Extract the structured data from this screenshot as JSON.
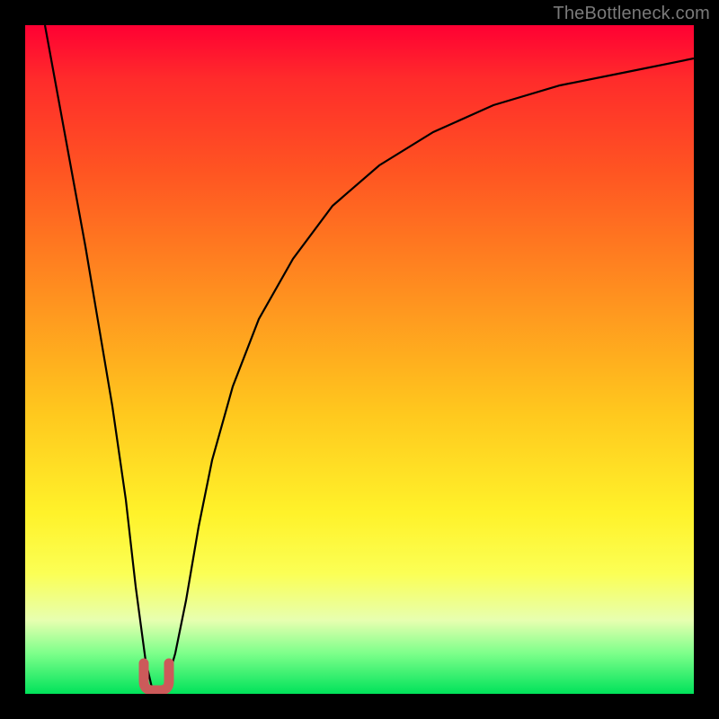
{
  "watermark": {
    "text": "TheBottleneck.com"
  },
  "chart_data": {
    "type": "line",
    "title": "",
    "xlabel": "",
    "ylabel": "",
    "xlim": [
      0,
      100
    ],
    "ylim": [
      0,
      100
    ],
    "grid": false,
    "legend": false,
    "background_gradient": {
      "direction": "vertical",
      "stops": [
        {
          "pos": 0,
          "color": "#ff0033"
        },
        {
          "pos": 22,
          "color": "#ff5522"
        },
        {
          "pos": 58,
          "color": "#ffc81e"
        },
        {
          "pos": 82,
          "color": "#fbff55"
        },
        {
          "pos": 100,
          "color": "#00e25a"
        }
      ]
    },
    "series": [
      {
        "name": "curve",
        "color": "#000000",
        "x": [
          3,
          5,
          7,
          9,
          11,
          13,
          15,
          16.5,
          18,
          19,
          20,
          21,
          22.5,
          24,
          26,
          28,
          31,
          35,
          40,
          46,
          53,
          61,
          70,
          80,
          90,
          100
        ],
        "y": [
          100,
          89,
          78,
          67,
          55,
          43,
          29,
          16,
          5,
          1,
          0,
          1,
          6,
          14,
          25,
          35,
          46,
          56,
          65,
          73,
          79,
          84,
          88,
          91,
          93,
          95
        ]
      }
    ],
    "markers": [
      {
        "shape": "u",
        "x": 19.5,
        "y": 0,
        "color": "#cc5a5a",
        "note": "small red U glyph at curve minimum"
      }
    ]
  }
}
